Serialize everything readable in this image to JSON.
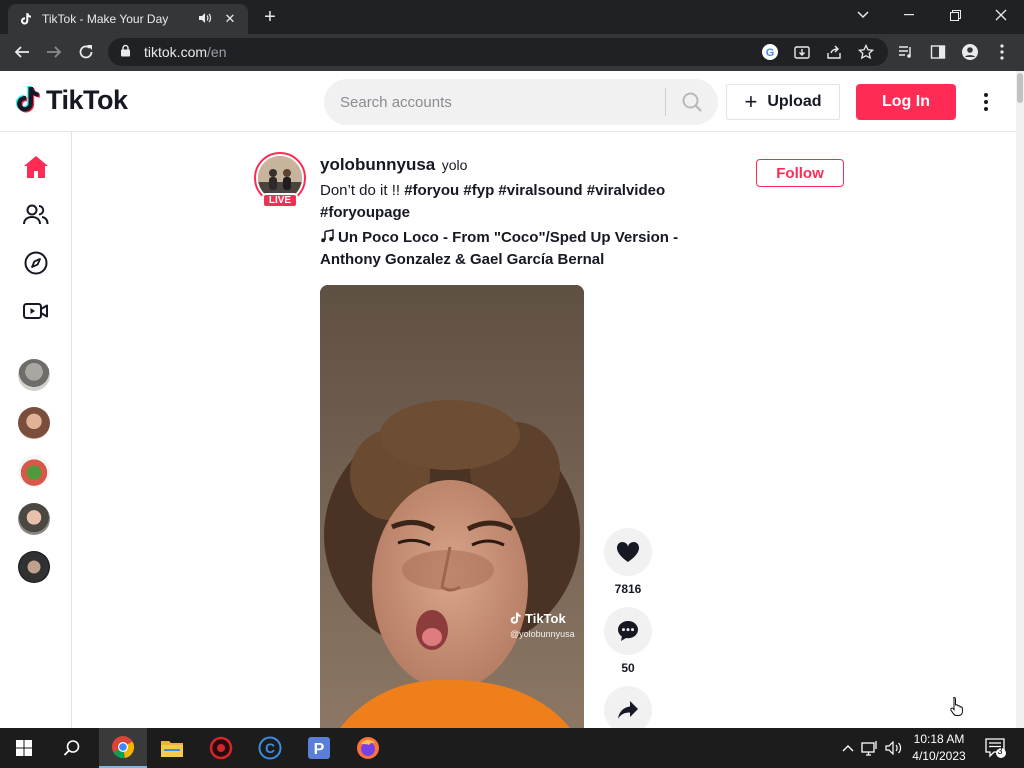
{
  "browser": {
    "tab_title": "TikTok - Make Your Day",
    "url_host": "tiktok.com",
    "url_path": "/en",
    "new_tab_label": "+"
  },
  "header": {
    "logo_text": "TikTok",
    "search_placeholder": "Search accounts",
    "upload_label": "Upload",
    "login_label": "Log In"
  },
  "sidebar": {
    "nav": [
      {
        "name": "home",
        "icon": "home-icon"
      },
      {
        "name": "following",
        "icon": "people-icon"
      },
      {
        "name": "explore",
        "icon": "compass-icon"
      },
      {
        "name": "live",
        "icon": "live-video-icon"
      }
    ],
    "accounts": [
      "account-1",
      "account-2",
      "account-3",
      "account-4",
      "account-5"
    ]
  },
  "post": {
    "live_badge": "LIVE",
    "username": "yolobunnyusa",
    "nickname": "yolo",
    "caption_text": "Don’t do it !! ",
    "caption_tags": "#foryou #fyp #viralsound #viralvideo #foryoupage",
    "music": "Un Poco Loco - From \"Coco\"/Sped Up Version - Anthony Gonzalez & Gael García Bernal",
    "follow_label": "Follow",
    "watermark_logo": "TikTok",
    "watermark_user": "@yolobunnyusa",
    "likes": "7816",
    "comments": "50"
  },
  "taskbar": {
    "time": "10:18 AM",
    "date": "4/10/2023",
    "notification_count": "3",
    "apps": [
      "start",
      "search",
      "chrome",
      "file-explorer",
      "app-red",
      "app-c",
      "app-p",
      "firefox"
    ]
  },
  "colors": {
    "brand": "#fe2c55",
    "text": "#161823"
  }
}
